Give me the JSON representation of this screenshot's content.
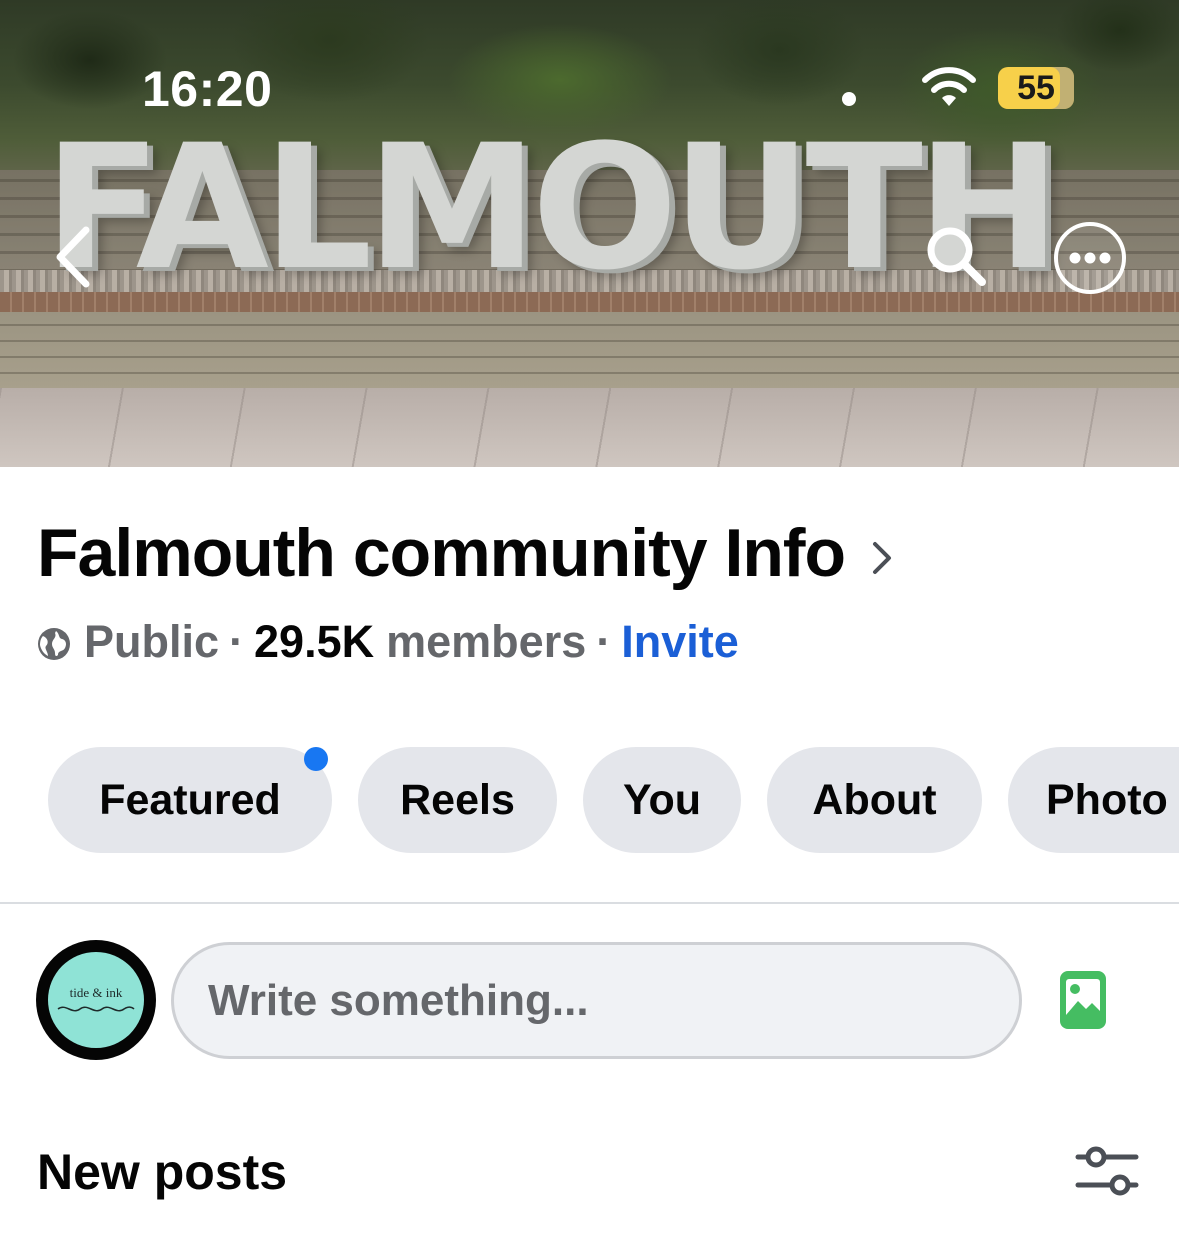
{
  "status_bar": {
    "time": "16:20",
    "battery": "55"
  },
  "cover": {
    "sign_text": "FALMOUTH"
  },
  "group": {
    "name": "Falmouth community Info",
    "privacy": "Public",
    "separator": "·",
    "member_count": "29.5K",
    "members_label": "members",
    "invite_label": "Invite"
  },
  "tabs": [
    {
      "label": "Featured",
      "has_notification_dot": true
    },
    {
      "label": "Reels"
    },
    {
      "label": "You"
    },
    {
      "label": "About"
    },
    {
      "label": "Photo"
    }
  ],
  "composer": {
    "avatar_text": "tide & ink",
    "placeholder": "Write something..."
  },
  "feed": {
    "section_title": "New posts"
  },
  "colors": {
    "accent": "#1877f2",
    "invite": "#1b5fd6",
    "secondary_text": "#65676b",
    "pill_bg": "#e4e6eb",
    "photo_icon": "#45bd62",
    "battery": "#f7d04a"
  },
  "icons": {
    "back": "chevron-left-icon",
    "search": "search-icon",
    "more": "more-icon",
    "title_chevron": "chevron-right-icon",
    "privacy": "globe-icon",
    "photo": "photo-icon",
    "filter": "filter-sliders-icon"
  }
}
